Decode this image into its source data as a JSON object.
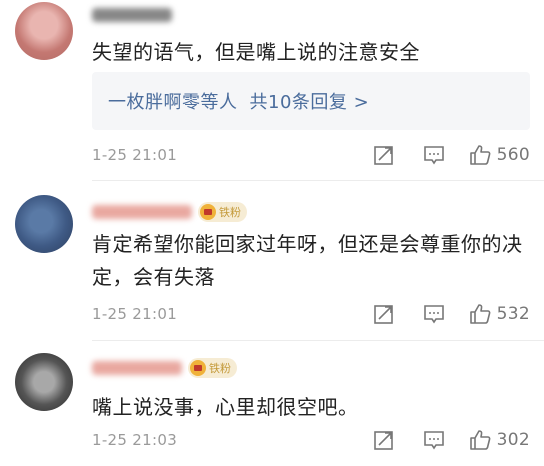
{
  "comments": [
    {
      "text": "失望的语气，但是嘴上说的注意安全",
      "replies_prefix": "一枚胖啊零等人",
      "replies_link": "共10条回复 >",
      "time": "1-25 21:01",
      "likes": "560"
    },
    {
      "badge": "铁粉",
      "text": "肯定希望你能回家过年呀，但还是会尊重你的决定，会有失落",
      "time": "1-25 21:01",
      "likes": "532"
    },
    {
      "badge": "铁粉",
      "text": "嘴上说没事，心里却很空吧。",
      "time": "1-25 21:03",
      "likes": "302"
    }
  ],
  "icons": {
    "share": "share-icon",
    "comment": "comment-icon",
    "like": "thumbs-up-icon"
  },
  "colors": {
    "link": "#4a6c9c",
    "meta": "#9a9a9a",
    "badge_bg": "#f6ecd4",
    "badge_text": "#c49a3a"
  }
}
